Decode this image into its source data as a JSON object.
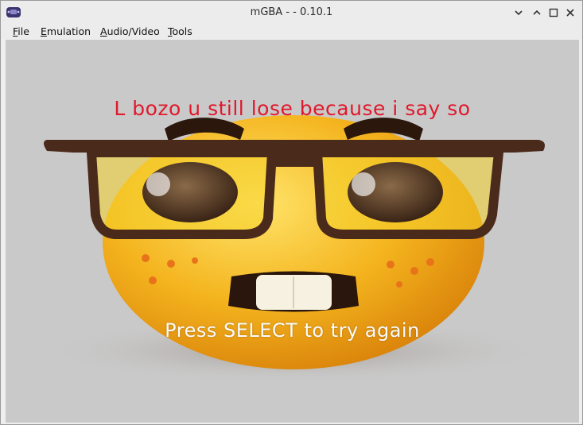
{
  "window": {
    "title": "mGBA -  - 0.10.1"
  },
  "menu": {
    "items": [
      {
        "label": "File",
        "underline": "F",
        "rest": "ile"
      },
      {
        "label": "Emulation",
        "underline": "E",
        "rest": "mulation"
      },
      {
        "label": "Audio/Video",
        "underline": "A",
        "rest": "udio/Video"
      },
      {
        "label": "Tools",
        "underline": "T",
        "rest": "ools"
      }
    ]
  },
  "game": {
    "top_caption": "L bozo u still lose because i say so",
    "bottom_caption": "Press SELECT to try again",
    "image_description": "nerd-emoji-with-glasses",
    "colors": {
      "background": "#c9c9c9",
      "face": "#f3b21c",
      "glasses": "#4a2a1a",
      "top_caption": "#e0192b",
      "bottom_caption": "#fbfbfb"
    }
  },
  "icons": {
    "app": "gba-app-icon",
    "minimize": "minimize-icon",
    "maximize": "maximize-icon",
    "close": "close-icon"
  }
}
